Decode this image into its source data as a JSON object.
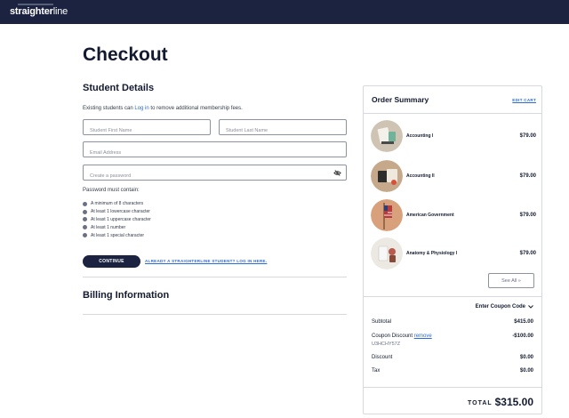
{
  "header": {
    "logo_bold": "straighter",
    "logo_light": "line"
  },
  "page": {
    "title": "Checkout",
    "student_details_heading": "Student Details",
    "intro_before": "Existing students can ",
    "intro_link": "Log in",
    "intro_after": " to remove additional membership fees.",
    "first_name_placeholder": "Student First Name",
    "last_name_placeholder": "Student Last Name",
    "email_placeholder": "Email Address",
    "password_placeholder": "Create a password",
    "password_rules_title": "Password must contain:",
    "password_rules": [
      "A minimum of 8 characters",
      "At least 1 lowercase character",
      "At least 1 uppercase character",
      "At least 1 number",
      "At least 1 special character"
    ],
    "continue_label": "CONTINUE",
    "login_link": "ALREADY A STRAIGHTERLINE STUDENT? LOG IN HERE.",
    "billing_heading": "Billing Information"
  },
  "summary": {
    "title": "Order Summary",
    "edit_label": "EDIT CART",
    "items": [
      {
        "name": "Accounting I",
        "price": "$79.00"
      },
      {
        "name": "Accounting II",
        "price": "$79.00"
      },
      {
        "name": "American Government",
        "price": "$79.00"
      },
      {
        "name": "Anatomy & Physiology I",
        "price": "$79.00"
      }
    ],
    "see_all_label": "See All",
    "coupon_toggle_label": "Enter Coupon Code",
    "subtotal_label": "Subtotal",
    "subtotal_value": "$415.00",
    "coupon_label": "Coupon Discount",
    "coupon_remove": "remove",
    "coupon_value": "-$100.00",
    "coupon_code": "U3HCHY57Z",
    "discount_label": "Discount",
    "discount_value": "$0.00",
    "tax_label": "Tax",
    "tax_value": "$0.00",
    "total_label": "TOTAL",
    "total_value": "$315.00"
  },
  "colors": {
    "navy": "#1b2340",
    "link": "#2c6bd6",
    "border": "#8c92a0",
    "divider": "#d7d9de"
  }
}
